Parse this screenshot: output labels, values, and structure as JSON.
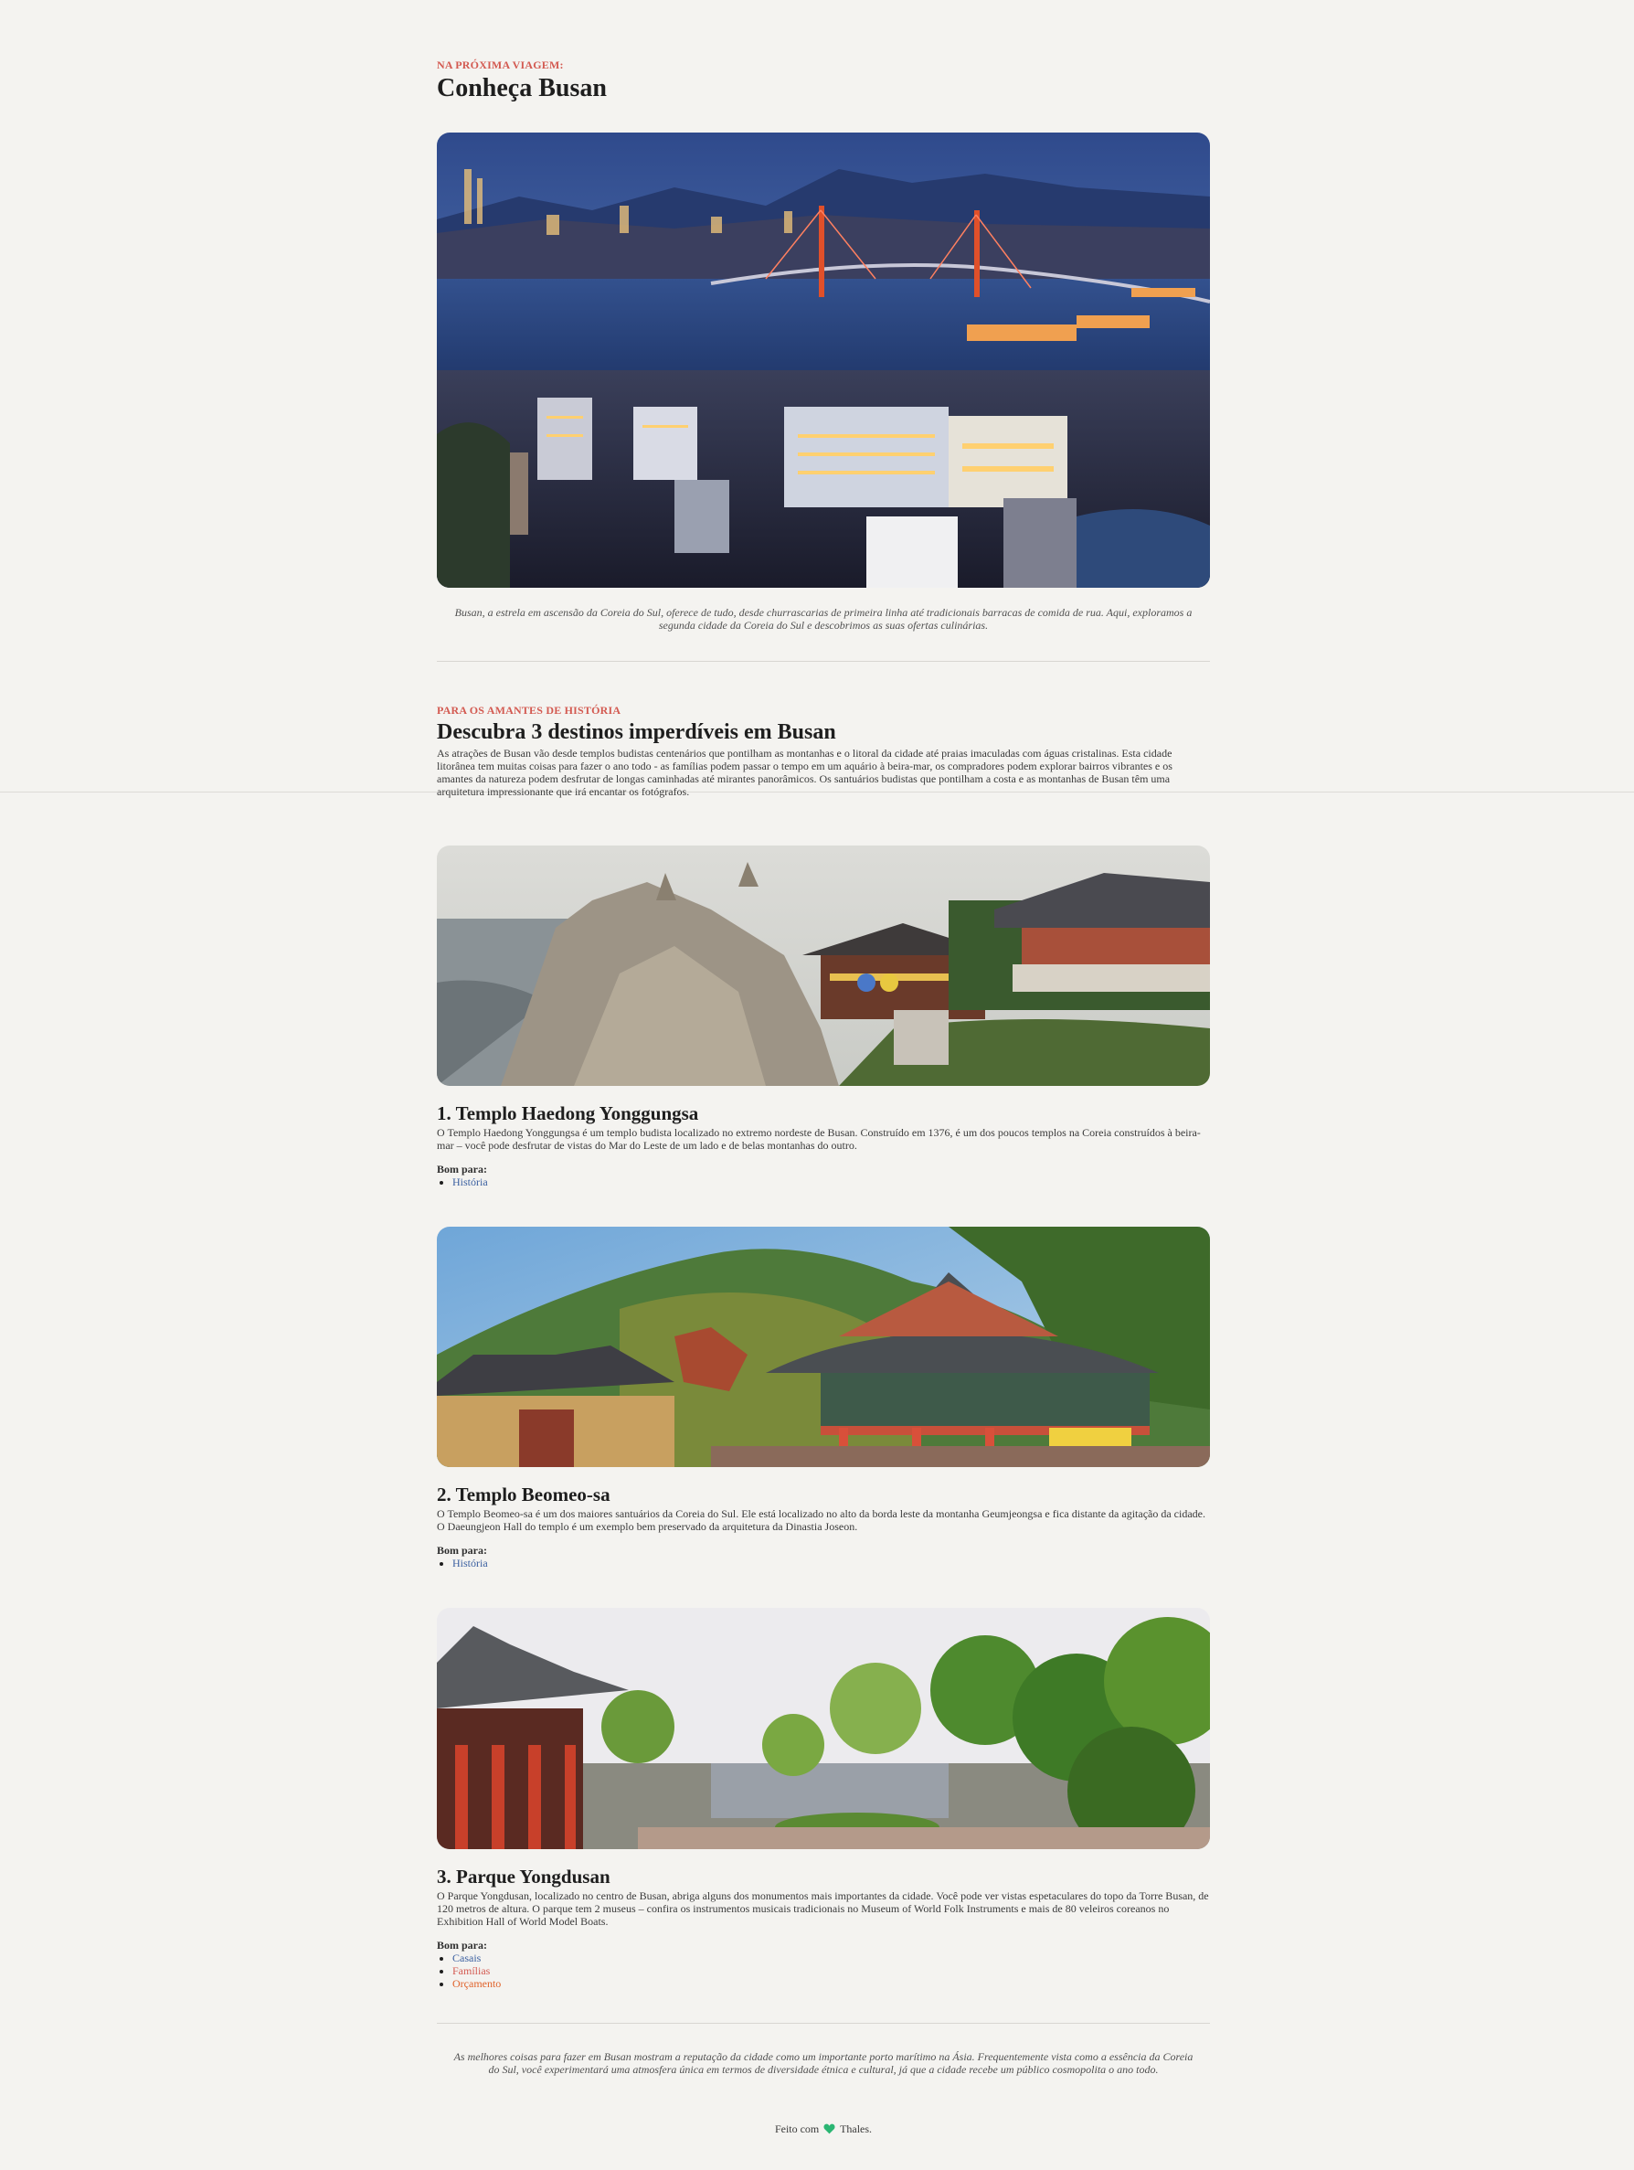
{
  "header": {
    "kicker": "NA PRÓXIMA VIAGEM:",
    "title": "Conheça Busan"
  },
  "hero": {
    "image_name": "busan-harbor-night-photo",
    "caption": "Busan, a estrela em ascensão da Coreia do Sul, oferece de tudo, desde churrascarias de primeira linha até tradicionais barracas de comida de rua. Aqui, exploramos a segunda cidade da Coreia do Sul e descobrimos as suas ofertas culinárias."
  },
  "section": {
    "kicker": "PARA OS AMANTES DE HISTÓRIA",
    "title": "Descubra 3 destinos imperdíveis em Busan",
    "intro": "As atrações de Busan vão desde templos budistas centenários que pontilham as montanhas e o litoral da cidade até praias imaculadas com águas cristalinas. Esta cidade litorânea tem muitas coisas para fazer o ano todo - as famílias podem passar o tempo em um aquário à beira-mar, os compradores podem explorar bairros vibrantes e os amantes da natureza podem desfrutar de longas caminhadas até mirantes panorâmicos. Os santuários budistas que pontilham a costa e as montanhas de Busan têm uma arquitetura impressionante que irá encantar os fotógrafos."
  },
  "destinations": [
    {
      "title": "1. Templo Haedong Yonggungsa",
      "description": "O Templo Haedong Yonggungsa é um templo budista localizado no extremo nordeste de Busan. Construído em 1376, é um dos poucos templos na Coreia construídos à beira-mar – você pode desfrutar de vistas do Mar do Leste de um lado e de belas montanhas do outro.",
      "good_for_label": "Bom para:",
      "tags": [
        "História"
      ]
    },
    {
      "title": "2. Templo Beomeo-sa",
      "description": "O Templo Beomeo-sa é um dos maiores santuários da Coreia do Sul. Ele está localizado no alto da borda leste da montanha Geumjeongsa e fica distante da agitação da cidade. O Daeungjeon Hall do templo é um exemplo bem preservado da arquitetura da Dinastia Joseon.",
      "good_for_label": "Bom para:",
      "tags": [
        "História"
      ]
    },
    {
      "title": "3. Parque Yongdusan",
      "description": "O Parque Yongdusan, localizado no centro de Busan, abriga alguns dos monumentos mais importantes da cidade. Você pode ver vistas espetaculares do topo da Torre Busan, de 120 metros de altura. O parque tem 2 museus – confira os instrumentos musicais tradicionais no Museum of World Folk Instruments e mais de 80 veleiros coreanos no Exhibition Hall of World Model Boats.",
      "good_for_label": "Bom para:",
      "tags": [
        "Casais",
        "Famílias",
        "Orçamento"
      ]
    }
  ],
  "closing": {
    "text": "As melhores coisas para fazer em Busan mostram a reputação da cidade como um importante porto marítimo na Ásia. Frequentemente vista como a essência da Coreia do Sul, você experimentará uma atmosfera única em termos de diversidade étnica e cultural, já que a cidade recebe um público cosmopolita o ano todo."
  },
  "footer": {
    "made_with": "Feito com",
    "heart_icon": "heart-icon",
    "author": "Thales."
  },
  "colors": {
    "background": "#f4f3f0",
    "kicker": "#d35a51",
    "link_blue": "#3a5fa0",
    "heart": "#2bb673"
  }
}
